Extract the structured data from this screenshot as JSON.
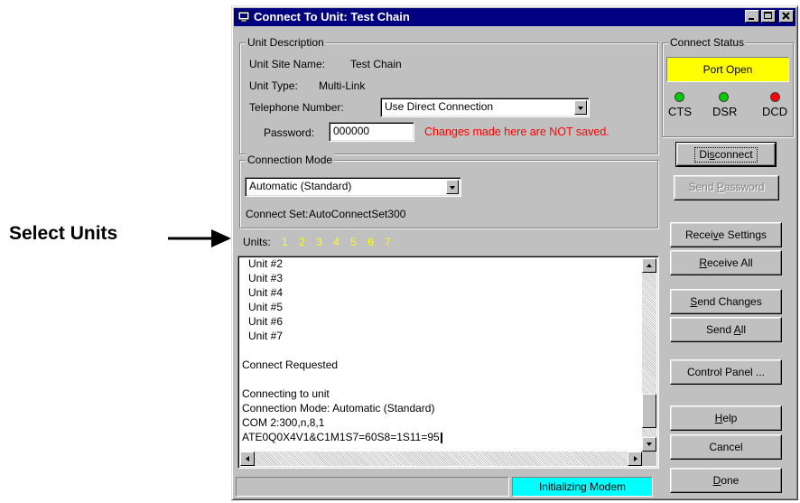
{
  "callout": {
    "text": "Select Units"
  },
  "window": {
    "title": "Connect To Unit: Test Chain",
    "controls": [
      "minimize-icon",
      "maximize-icon",
      "close-icon"
    ]
  },
  "unit_description": {
    "label": "Unit Description",
    "site_name_label": "Unit Site Name:",
    "site_name_value": "Test Chain",
    "type_label": "Unit Type:",
    "type_value": "Multi-Link",
    "phone_label": "Telephone Number:",
    "phone_value": "Use Direct Connection",
    "password_label": "Password:",
    "password_value": "000000",
    "warning": "Changes made here are NOT saved."
  },
  "connect_status": {
    "label": "Connect Status",
    "status_text": "Port Open",
    "status_color": "#ffff00",
    "leds": [
      {
        "label": "CTS",
        "color": "#00cc00"
      },
      {
        "label": "DSR",
        "color": "#00cc00"
      },
      {
        "label": "DCD",
        "color": "#ff0000"
      }
    ]
  },
  "connection_mode": {
    "label": "Connection Mode",
    "mode_value": "Automatic (Standard)",
    "connect_set_label": "Connect Set:",
    "connect_set_value": "AutoConnectSet300"
  },
  "units": {
    "label": "Units:",
    "numbers": [
      "1",
      "2",
      "3",
      "4",
      "5",
      "6",
      "7"
    ],
    "number_color": "#ffff00"
  },
  "log": {
    "lines": [
      {
        "text": "Unit #2",
        "indent": true
      },
      {
        "text": "Unit #3",
        "indent": true
      },
      {
        "text": "Unit #4",
        "indent": true
      },
      {
        "text": "Unit #5",
        "indent": true
      },
      {
        "text": "Unit #6",
        "indent": true
      },
      {
        "text": "Unit #7",
        "indent": true
      },
      {
        "text": "",
        "indent": false
      },
      {
        "text": "Connect Requested",
        "indent": false
      },
      {
        "text": "",
        "indent": false
      },
      {
        "text": "Connecting to unit",
        "indent": false
      },
      {
        "text": "Connection Mode: Automatic (Standard)",
        "indent": false
      },
      {
        "text": "COM 2:300,n,8,1",
        "indent": false
      },
      {
        "text": "ATE0Q0X4V1&C1M1S7=60S8=1S11=95",
        "indent": false
      }
    ]
  },
  "buttons": {
    "disconnect": {
      "pre": "Di",
      "acc": "s",
      "post": "connect"
    },
    "send_password": {
      "pre": "Send ",
      "acc": "P",
      "post": "assword"
    },
    "receive_settings": {
      "pre": "Recei",
      "acc": "v",
      "post": "e Settings"
    },
    "receive_all": {
      "pre": "",
      "acc": "R",
      "post": "eceive All"
    },
    "send_changes": {
      "pre": "",
      "acc": "S",
      "post": "end Changes"
    },
    "send_all": {
      "pre": "Send ",
      "acc": "A",
      "post": "ll"
    },
    "control_panel": {
      "pre": "Control Panel ...",
      "acc": "",
      "post": ""
    },
    "help": {
      "pre": "",
      "acc": "H",
      "post": "elp"
    },
    "cancel": {
      "pre": "Cancel",
      "acc": "",
      "post": ""
    },
    "done": {
      "pre": "",
      "acc": "D",
      "post": "one"
    }
  },
  "statusbar": {
    "message": "Initializing Modem",
    "message_color": "#00ffff"
  }
}
